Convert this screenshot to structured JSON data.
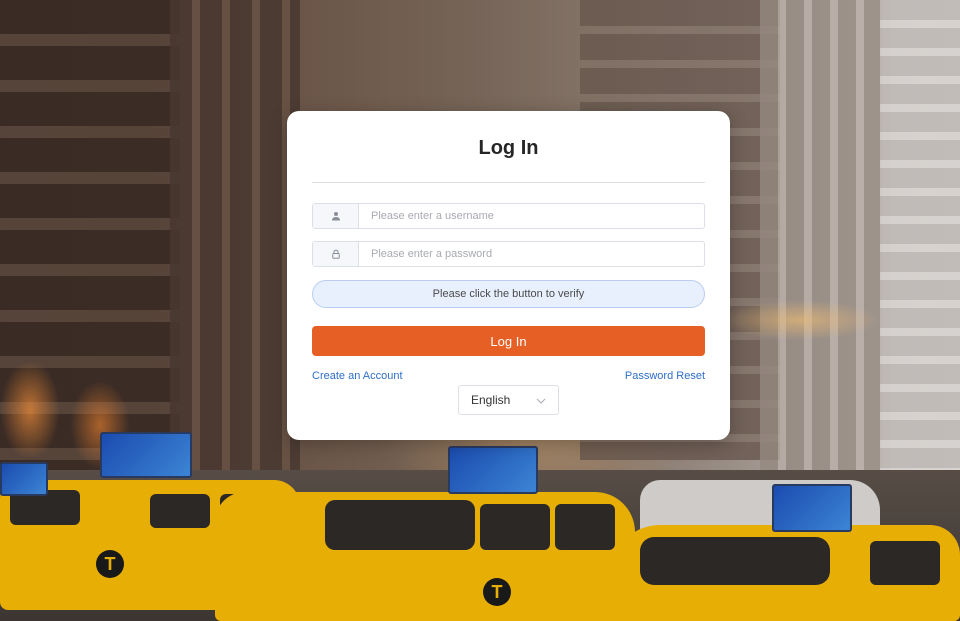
{
  "login": {
    "title": "Log In",
    "username": {
      "value": "",
      "placeholder": "Please enter a username",
      "icon": "user-icon"
    },
    "password": {
      "value": "",
      "placeholder": "Please enter a password",
      "icon": "lock-icon"
    },
    "verify_label": "Please click the button to verify",
    "submit_label": "Log In",
    "create_account_label": "Create an Account",
    "password_reset_label": "Password Reset",
    "language": {
      "selected": "English",
      "icon": "chevron-down-icon"
    }
  },
  "colors": {
    "accent": "#e65f24",
    "link": "#2f6fc9",
    "verify_bg": "#e8f0fe"
  }
}
